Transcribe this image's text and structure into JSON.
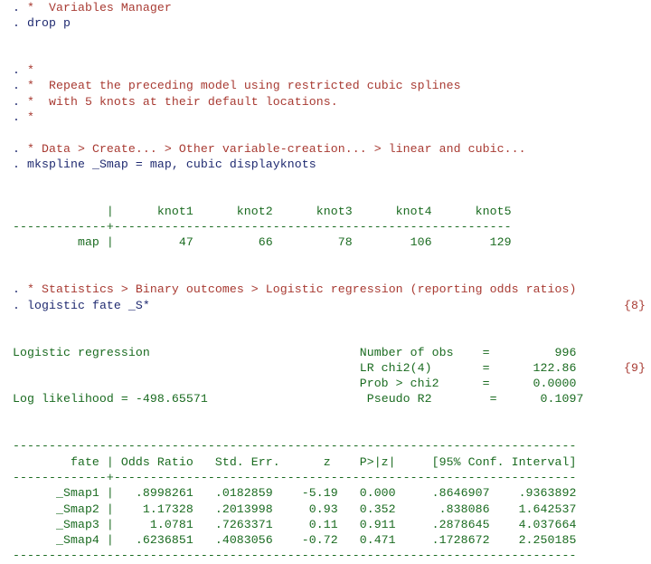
{
  "window": {
    "title": "Stata Results",
    "background": "#ffffff",
    "colors": {
      "comment": "#a83a32",
      "command": "#1f2a70",
      "result": "#1a6b20",
      "note": "#a83a32"
    }
  },
  "lines": {
    "l01_prompt": ". ",
    "l01_comment": "*  Variables Manager",
    "l02_prompt": ". ",
    "l02_command": "drop p",
    "l03_prompt": ". ",
    "l03_comment": "*",
    "l04_prompt": ". ",
    "l04_comment": "*  Repeat the preceding model using restricted cubic splines",
    "l05_prompt": ". ",
    "l05_comment": "*  with 5 knots at their default locations.",
    "l06_prompt": ". ",
    "l06_comment": "*",
    "l07_prompt": ". ",
    "l07_comment": "* Data > Create... > Other variable-creation... > linear and cubic...",
    "l08_prompt": ". ",
    "l08_command": "mkspline _Smap = map, cubic displayknots",
    "l09_prompt": ". ",
    "l09_comment": "* Statistics > Binary outcomes > Logistic regression (reporting odds ratios)",
    "l10_prompt": ". ",
    "l10_command": "logistic fate _S*",
    "l10_note": "{8}"
  },
  "knots_table": {
    "header": "             |      knot1      knot2      knot3      knot4      knot5",
    "separator": "-------------+-------------------------------------------------------",
    "row_map": "         map |         47         66         78        106        129"
  },
  "regression_header": {
    "title": "Logistic regression",
    "loglik": "Log likelihood = -498.65571",
    "stat_rows": [
      {
        "label": "Number of obs",
        "eq": "=",
        "value": "996",
        "note": ""
      },
      {
        "label": "LR chi2(4)",
        "eq": "=",
        "value": "122.86",
        "note": "{9}"
      },
      {
        "label": "Prob > chi2",
        "eq": "=",
        "value": "0.0000",
        "note": ""
      },
      {
        "label": "Pseudo R2",
        "eq": "=",
        "value": "0.1097",
        "note": ""
      }
    ]
  },
  "results_table": {
    "rule_top": "------------------------------------------------------------------------------",
    "header": "        fate | Odds Ratio   Std. Err.      z    P>|z|     [95% Conf. Interval]",
    "separator": "-------------+----------------------------------------------------------------",
    "rows": [
      "      _Smap1 |   .8998261   .0182859    -5.19   0.000     .8646907    .9363892",
      "      _Smap2 |    1.17328   .2013998     0.93   0.352      .838086    1.642537",
      "      _Smap3 |     1.0781   .7263371     0.11   0.911     .2878645    4.037664",
      "      _Smap4 |   .6236851   .4083056    -0.72   0.471     .1728672    2.250185"
    ],
    "rule_bottom": "------------------------------------------------------------------------------",
    "columns": [
      "fate",
      "Odds Ratio",
      "Std. Err.",
      "z",
      "P>|z|",
      "[95% Conf. Interval]"
    ],
    "data": [
      {
        "variable": "_Smap1",
        "odds_ratio": ".8998261",
        "std_err": ".0182859",
        "z": "-5.19",
        "p": "0.000",
        "ci_low": ".8646907",
        "ci_high": ".9363892"
      },
      {
        "variable": "_Smap2",
        "odds_ratio": "1.17328",
        "std_err": ".2013998",
        "z": "0.93",
        "p": "0.352",
        "ci_low": ".838086",
        "ci_high": "1.642537"
      },
      {
        "variable": "_Smap3",
        "odds_ratio": "1.0781",
        "std_err": ".7263371",
        "z": "0.11",
        "p": "0.911",
        "ci_low": ".2878645",
        "ci_high": "4.037664"
      },
      {
        "variable": "_Smap4",
        "odds_ratio": ".6236851",
        "std_err": ".4083056",
        "z": "-0.72",
        "p": "0.471",
        "ci_low": ".1728672",
        "ci_high": "2.250185"
      }
    ]
  }
}
